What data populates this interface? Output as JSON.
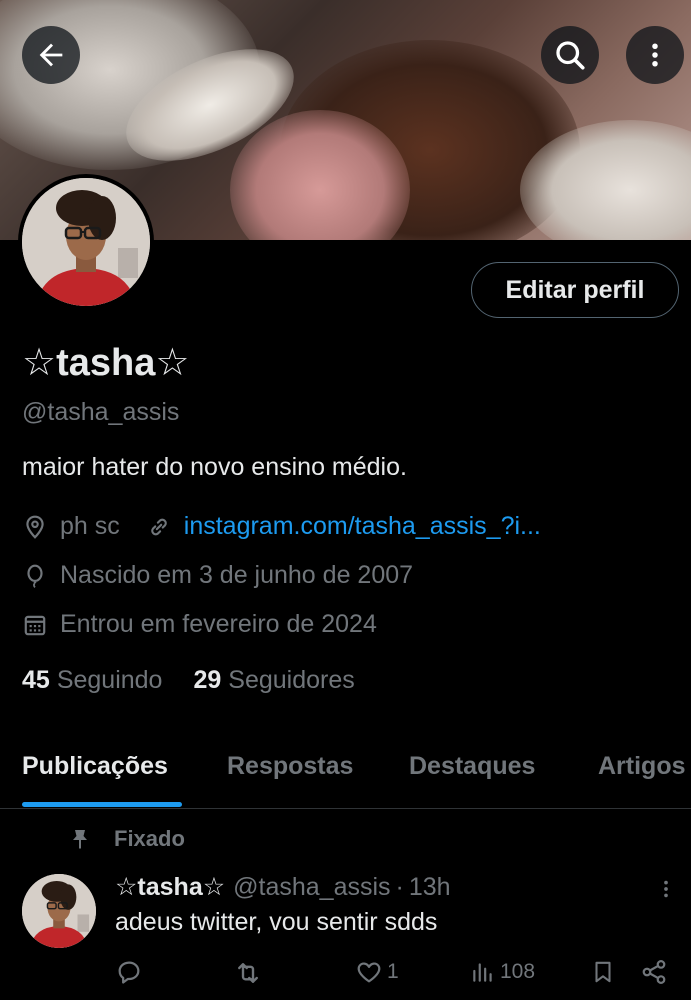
{
  "header": {
    "back_icon": "arrow-left-icon",
    "search_icon": "search-icon",
    "more_icon": "more-vertical-icon"
  },
  "profile": {
    "display_name": "☆tasha☆",
    "handle": "@tasha_assis",
    "bio": "maior hater do novo ensino médio.",
    "location": "ph sc",
    "website": "instagram.com/tasha_assis_?i...",
    "birthday": "Nascido em 3 de junho de 2007",
    "joined": "Entrou em fevereiro de 2024",
    "following_count": "45",
    "following_label": "Seguindo",
    "followers_count": "29",
    "followers_label": "Seguidores",
    "edit_button": "Editar perfil"
  },
  "tabs": [
    {
      "label": "Publicações",
      "active": true
    },
    {
      "label": "Respostas",
      "active": false
    },
    {
      "label": "Destaques",
      "active": false
    },
    {
      "label": "Artigos",
      "active": false
    }
  ],
  "pinned_post": {
    "pinned_label": "Fixado",
    "author_name": "☆tasha☆",
    "author_handle": "@tasha_assis",
    "separator": "·",
    "time": "13h",
    "text": "adeus twitter, vou sentir sdds",
    "likes": "1",
    "views": "108"
  },
  "colors": {
    "accent": "#1d9bf0",
    "muted": "#71767b",
    "text": "#e7e9ea",
    "background": "#000000"
  }
}
